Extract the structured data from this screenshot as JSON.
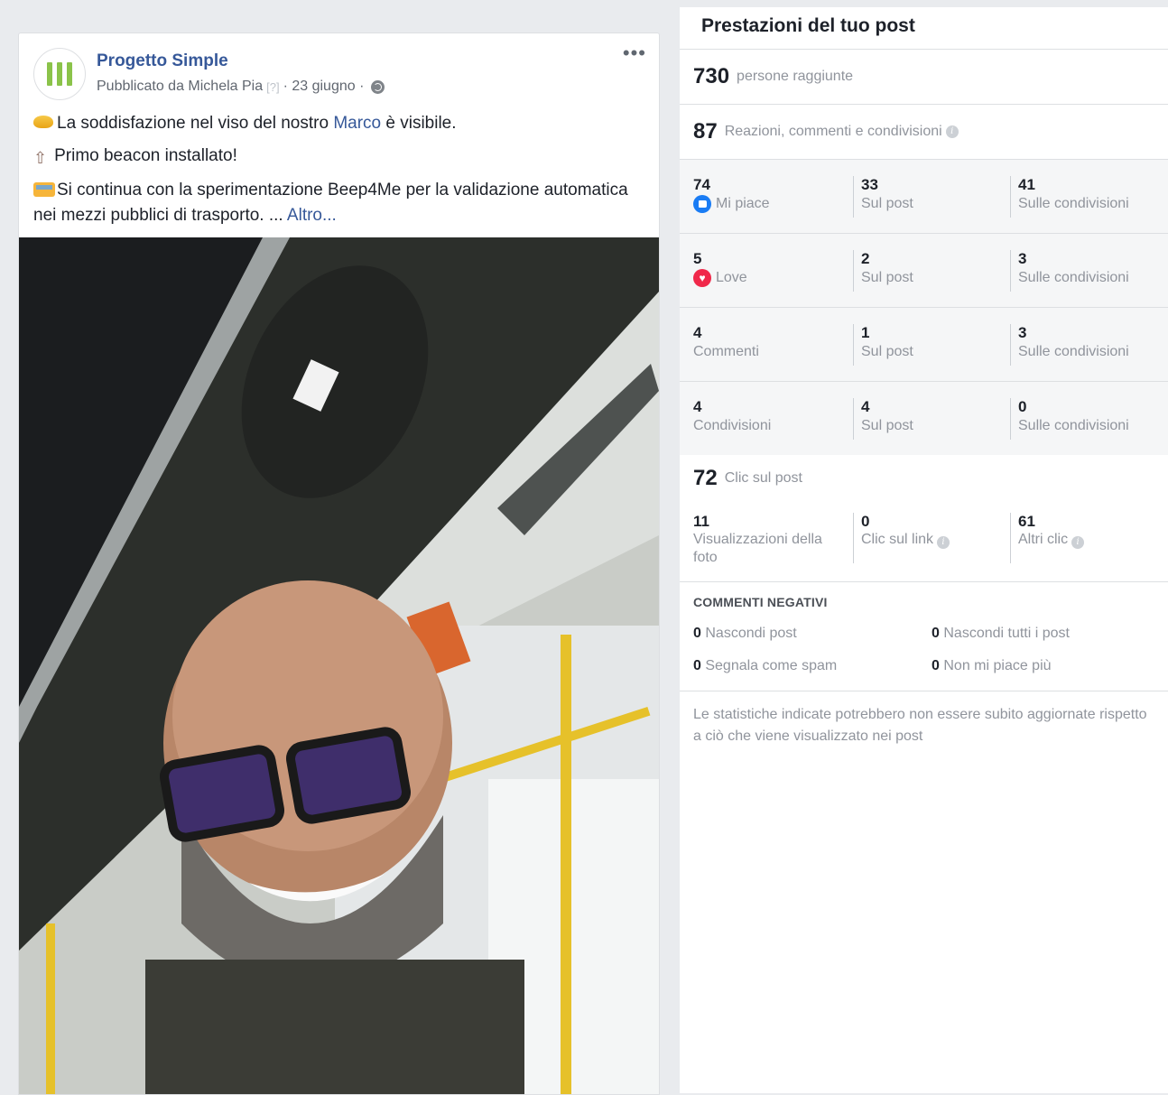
{
  "post": {
    "page_name": "Progetto Simple",
    "published_by": "Pubblicato da Michela Pia",
    "help_mark": "[?]",
    "date": "· 23 giugno ·",
    "more": "•••",
    "line1_pre": "La soddisfazione nel viso del nostro ",
    "line1_link": "Marco",
    "line1_post": " è visibile.",
    "line2": "Primo beacon installato!",
    "line3": "Si continua con la sperimentazione Beep4Me per la validazione automatica nei mezzi pubblici di trasporto. ... ",
    "more_link": "Altro..."
  },
  "insights": {
    "title": "Prestazioni del tuo post",
    "reach": {
      "value": "730",
      "label": "persone raggiunte"
    },
    "engagement": {
      "value": "87",
      "label": "Reazioni, commenti e condivisioni"
    },
    "rows": [
      {
        "total": "74",
        "label": "Mi piace",
        "icon": "like-icon",
        "on_post": "33",
        "on_post_label": "Sul post",
        "on_shares": "41",
        "on_shares_label": "Sulle condivisioni"
      },
      {
        "total": "5",
        "label": "Love",
        "icon": "love-icon",
        "on_post": "2",
        "on_post_label": "Sul post",
        "on_shares": "3",
        "on_shares_label": "Sulle condivisioni"
      },
      {
        "total": "4",
        "label": "Commenti",
        "on_post": "1",
        "on_post_label": "Sul post",
        "on_shares": "3",
        "on_shares_label": "Sulle condivisioni"
      },
      {
        "total": "4",
        "label": "Condivisioni",
        "on_post": "4",
        "on_post_label": "Sul post",
        "on_shares": "0",
        "on_shares_label": "Sulle condivisioni"
      }
    ],
    "clicks": {
      "value": "72",
      "label": "Clic sul post",
      "photo_views": "11",
      "photo_views_label": "Visualizzazioni della foto",
      "link_clicks": "0",
      "link_clicks_label": "Clic sul link",
      "other_clicks": "61",
      "other_clicks_label": "Altri clic"
    },
    "negative": {
      "title": "COMMENTI NEGATIVI",
      "hide_post": "0",
      "hide_post_label": "Nascondi post",
      "hide_all": "0",
      "hide_all_label": "Nascondi tutti i post",
      "spam": "0",
      "spam_label": "Segnala come spam",
      "unlike": "0",
      "unlike_label": "Non mi piace più"
    },
    "footnote": "Le statistiche indicate potrebbero non essere subito aggiornate rispetto a ciò che viene visualizzato nei post"
  }
}
